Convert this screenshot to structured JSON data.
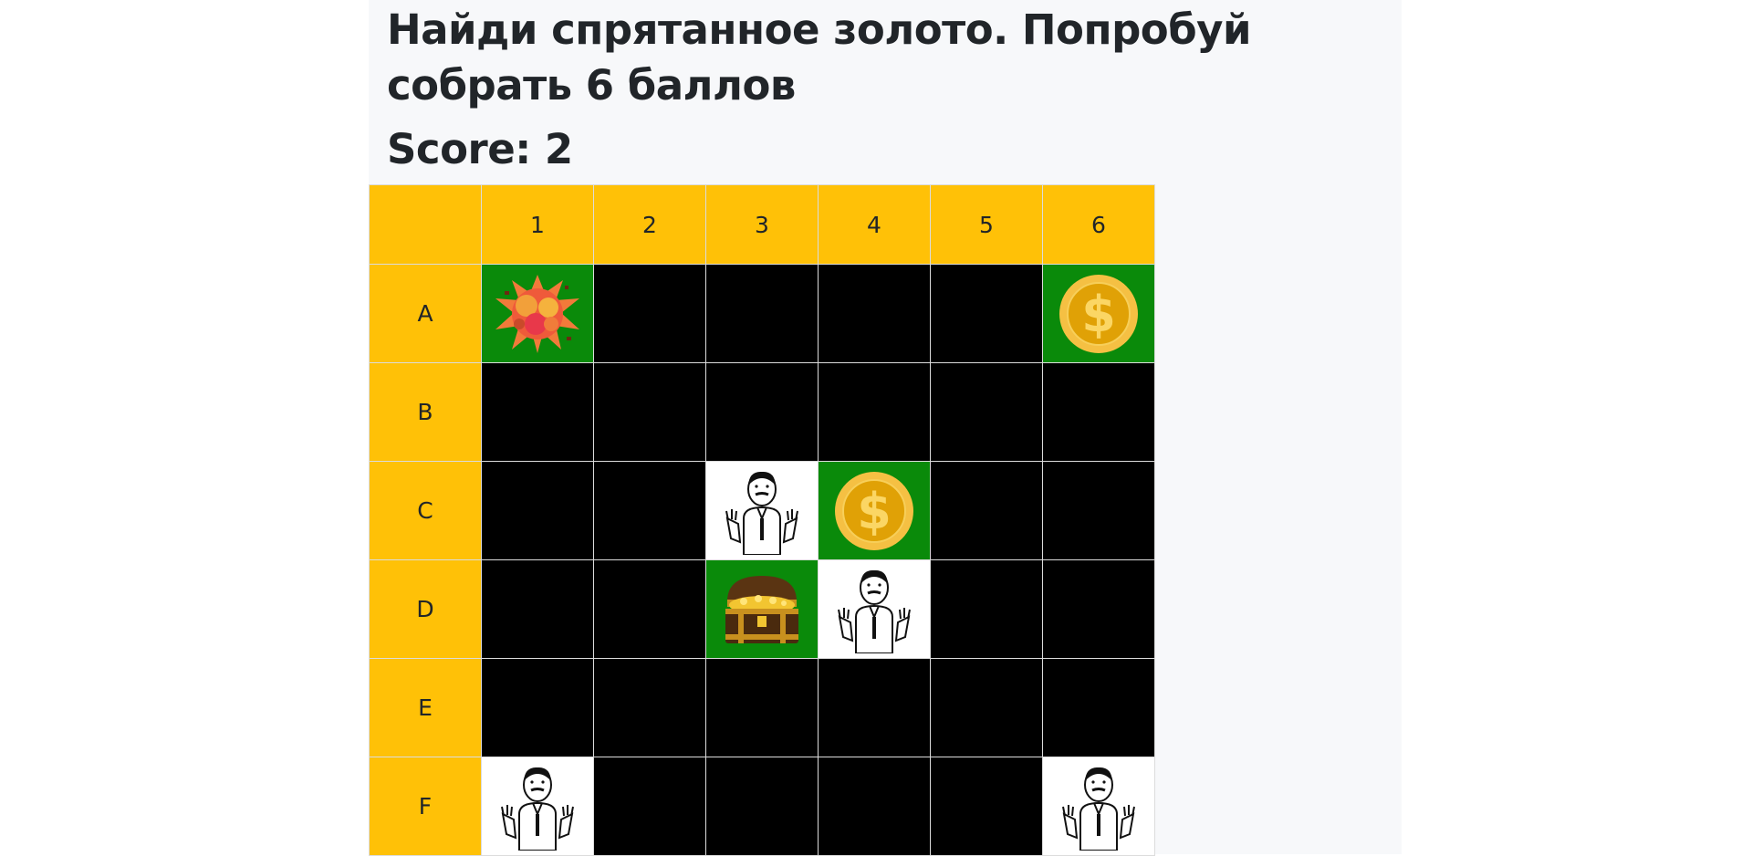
{
  "game": {
    "title": "Найди спрятанное золото. Попробуй собрать 6 баллов",
    "score_text": "Score: 2"
  },
  "board": {
    "column_headers": [
      "1",
      "2",
      "3",
      "4",
      "5",
      "6"
    ],
    "row_headers": [
      "A",
      "B",
      "C",
      "D",
      "E",
      "F"
    ],
    "legend": {
      "hidden": "black square - unopened cell",
      "coin": "gold coin on green",
      "chest": "treasure chest on green",
      "bomb": "explosion on green",
      "empty": "meme face on white"
    },
    "cells": [
      [
        "bomb",
        "hidden",
        "hidden",
        "hidden",
        "hidden",
        "coin"
      ],
      [
        "hidden",
        "hidden",
        "hidden",
        "hidden",
        "hidden",
        "hidden"
      ],
      [
        "hidden",
        "hidden",
        "empty",
        "coin",
        "hidden",
        "hidden"
      ],
      [
        "hidden",
        "hidden",
        "chest",
        "empty",
        "hidden",
        "hidden"
      ],
      [
        "hidden",
        "hidden",
        "hidden",
        "hidden",
        "hidden",
        "hidden"
      ],
      [
        "empty",
        "hidden",
        "hidden",
        "hidden",
        "hidden",
        "empty"
      ]
    ]
  },
  "colors": {
    "header_bg": "#ffc107",
    "hidden_bg": "#000000",
    "found_bg": "#0a8a0a",
    "empty_bg": "#ffffff",
    "text": "#212529",
    "page_bg": "#f7f8fa"
  }
}
